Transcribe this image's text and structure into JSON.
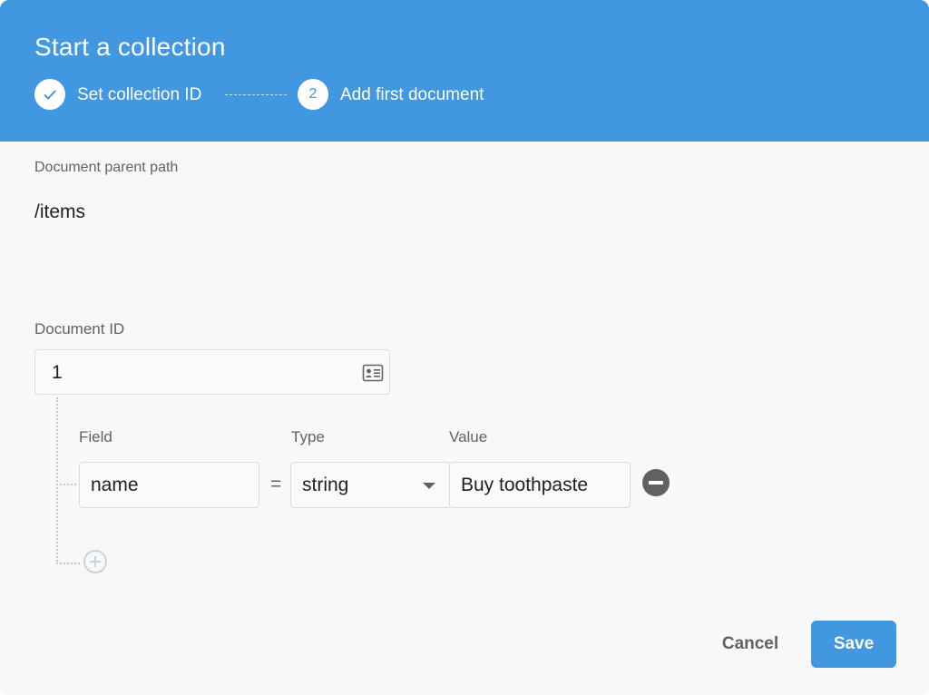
{
  "dialog": {
    "title": "Start a collection"
  },
  "stepper": {
    "steps": [
      {
        "marker": "check",
        "label": "Set collection ID",
        "state": "completed"
      },
      {
        "marker": "2",
        "label": "Add first document",
        "state": "active"
      }
    ]
  },
  "parent_path": {
    "label": "Document parent path",
    "value": "/items"
  },
  "document_id": {
    "label": "Document ID",
    "value": "1",
    "icon": "id-card-icon"
  },
  "fields": {
    "headers": {
      "field": "Field",
      "type": "Type",
      "value": "Value"
    },
    "rows": [
      {
        "name": "name",
        "equals": "=",
        "type": "string",
        "value": "Buy toothpaste"
      }
    ],
    "add_icon": "add-circle-icon",
    "remove_icon": "remove-circle-icon"
  },
  "actions": {
    "cancel_label": "Cancel",
    "save_label": "Save"
  },
  "colors": {
    "accent": "#4298e0",
    "background": "#f8f8f8",
    "text": "#202124",
    "muted": "#5f6368"
  }
}
